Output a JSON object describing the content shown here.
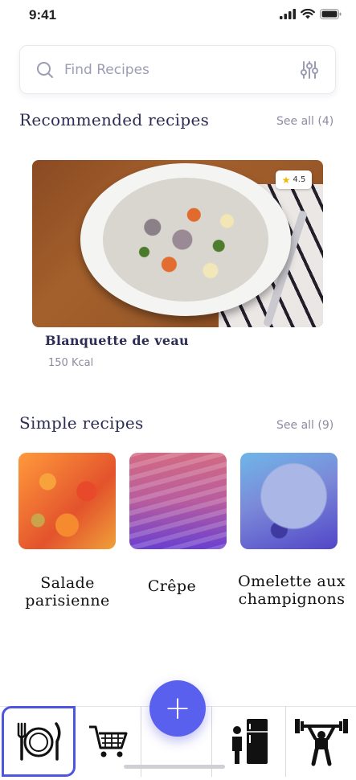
{
  "status": {
    "time": "9:41"
  },
  "search": {
    "placeholder": "Find Recipes"
  },
  "recommended": {
    "title": "Recommended recipes",
    "see_all": "See all (4)",
    "featured": {
      "name": "Blanquette de veau",
      "kcal": "150 Kcal",
      "rating": "4.5"
    }
  },
  "simple": {
    "title": "Simple recipes",
    "see_all": "See all (9)",
    "items": [
      {
        "line1": "Salade",
        "line2": "parisienne"
      },
      {
        "line1": "Crêpe",
        "line2": ""
      },
      {
        "line1": "Omelette aux",
        "line2": "champignons"
      }
    ]
  },
  "nav": {
    "items": [
      "plate-cutlery-icon",
      "shopping-cart-icon",
      "add-icon",
      "fridge-icon",
      "weightlifting-icon"
    ],
    "fab_symbol": "+"
  },
  "colors": {
    "accent": "#5a60ee",
    "title": "#2c2c54",
    "muted": "#8c8ca3"
  }
}
